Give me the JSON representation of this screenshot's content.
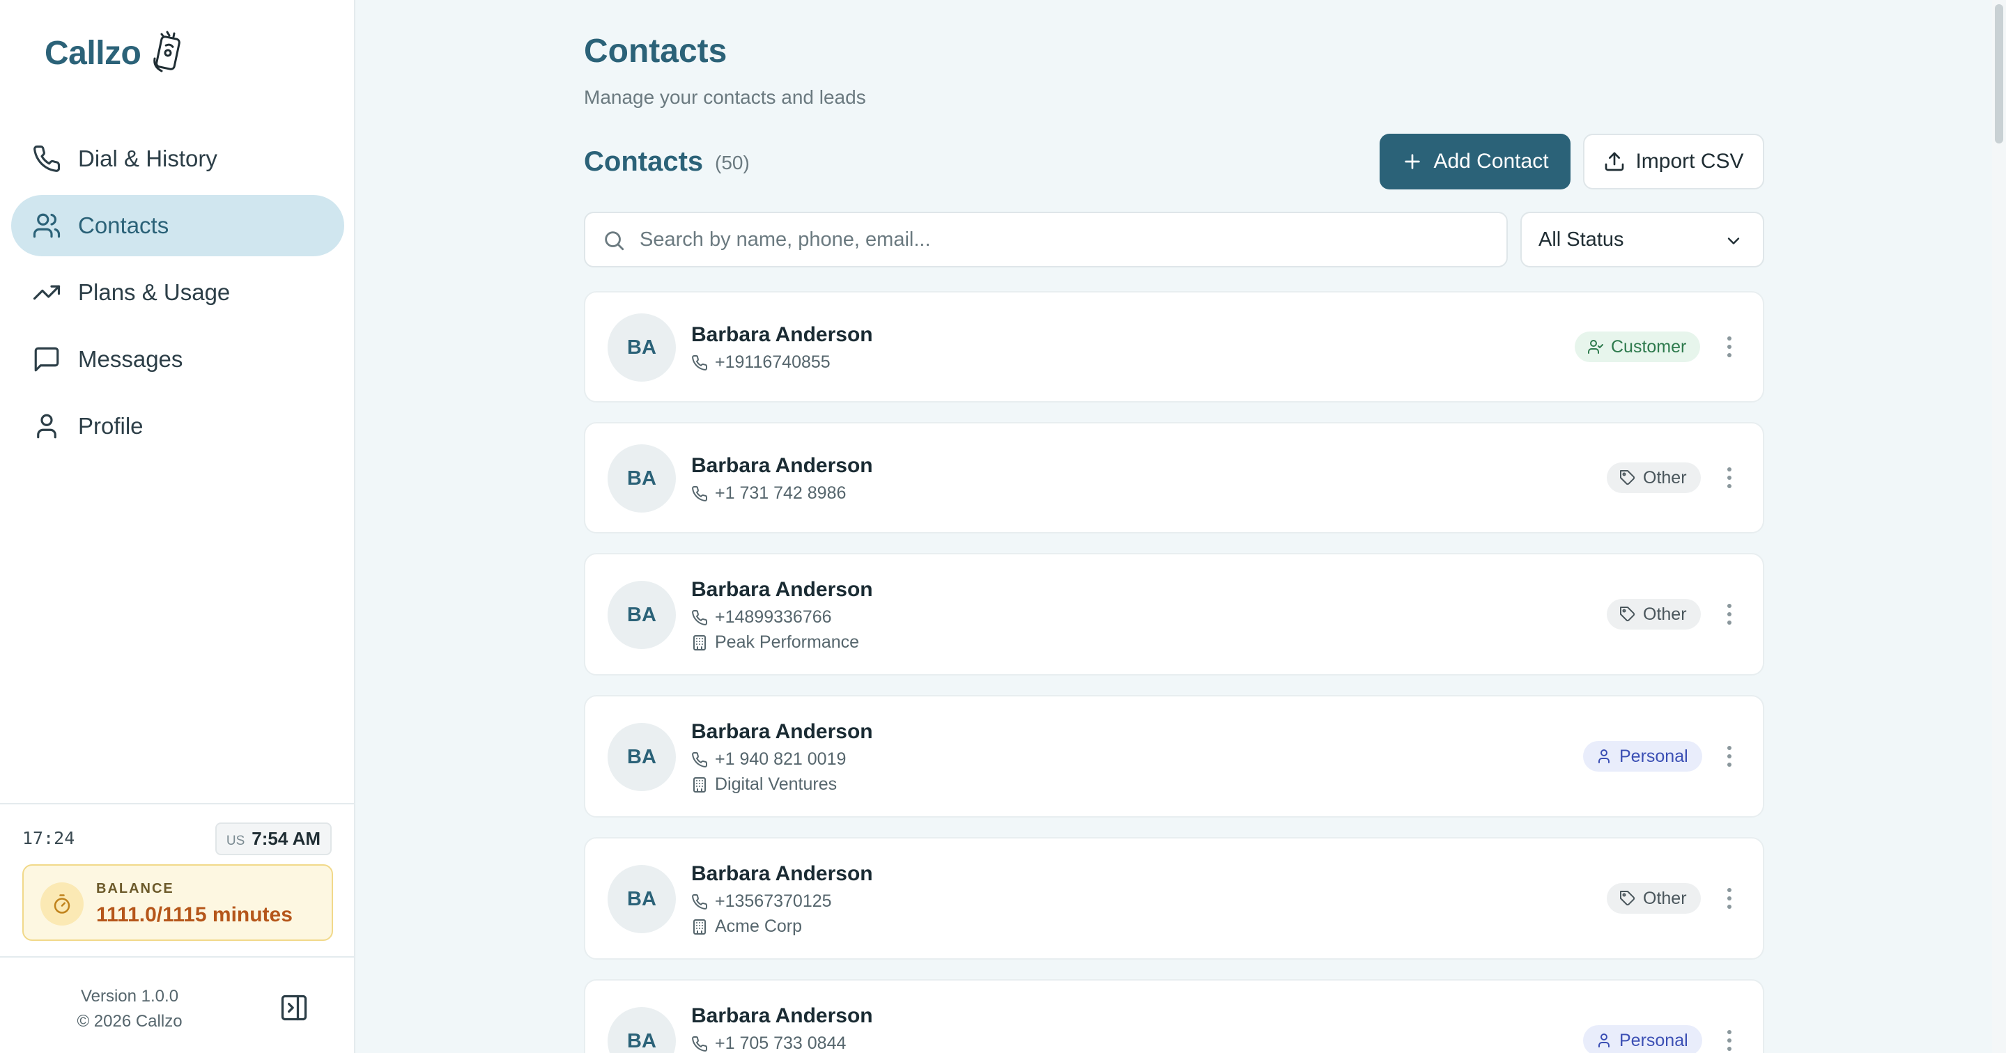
{
  "app": {
    "name": "Callzo"
  },
  "sidebar": {
    "items": [
      {
        "label": "Dial & History",
        "icon": "phone-icon"
      },
      {
        "label": "Contacts",
        "icon": "users-icon",
        "active": true
      },
      {
        "label": "Plans & Usage",
        "icon": "trending-up-icon"
      },
      {
        "label": "Messages",
        "icon": "message-icon"
      },
      {
        "label": "Profile",
        "icon": "user-icon"
      }
    ],
    "clock": "17:24",
    "timezone": {
      "code": "US",
      "time": "7:54 AM"
    },
    "balance": {
      "label": "BALANCE",
      "value": "1111.0/1115 minutes"
    },
    "version": "Version 1.0.0",
    "copyright": "© 2026 Callzo"
  },
  "page": {
    "title": "Contacts",
    "subtitle": "Manage your contacts and leads",
    "section_title": "Contacts",
    "count": "(50)",
    "add_label": "Add Contact",
    "import_label": "Import CSV",
    "search_placeholder": "Search by name, phone, email...",
    "status_filter": "All Status"
  },
  "contacts": [
    {
      "initials": "BA",
      "name": "Barbara Anderson",
      "phone": "+19116740855",
      "company": "",
      "tag": "Customer"
    },
    {
      "initials": "BA",
      "name": "Barbara Anderson",
      "phone": "+1 731 742 8986",
      "company": "",
      "tag": "Other"
    },
    {
      "initials": "BA",
      "name": "Barbara Anderson",
      "phone": "+14899336766",
      "company": "Peak Performance",
      "tag": "Other"
    },
    {
      "initials": "BA",
      "name": "Barbara Anderson",
      "phone": "+1 940 821 0019",
      "company": "Digital Ventures",
      "tag": "Personal"
    },
    {
      "initials": "BA",
      "name": "Barbara Anderson",
      "phone": "+13567370125",
      "company": "Acme Corp",
      "tag": "Other"
    },
    {
      "initials": "BA",
      "name": "Barbara Anderson",
      "phone": "+1 705 733 0844",
      "company": "",
      "tag": "Personal"
    }
  ],
  "colors": {
    "brand": "#2b6278",
    "active_nav": "#d0e6ef",
    "balance_value": "#b5561a"
  }
}
